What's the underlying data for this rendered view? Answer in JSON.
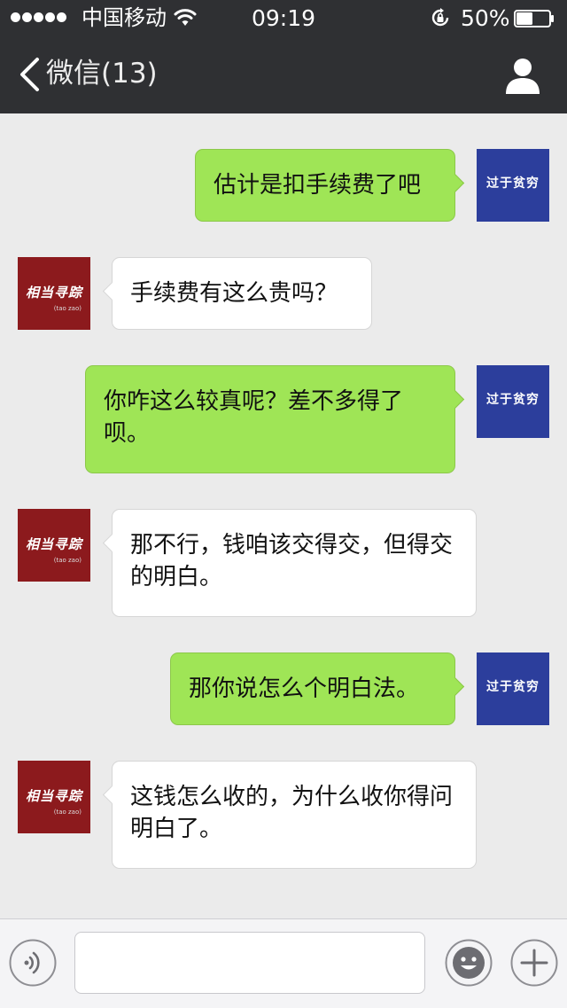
{
  "status_bar": {
    "signal_bars": 5,
    "carrier": "中国移动",
    "time": "09:19",
    "battery_text": "50%",
    "battery_level": 0.5
  },
  "nav": {
    "back_label": "微信(13)",
    "back_icon": "chevron-left-icon",
    "profile_icon": "person-icon"
  },
  "avatars": {
    "me": {
      "text": "过于贫穷",
      "bg": "#2c3e9c"
    },
    "them": {
      "text": "相当寻踪",
      "subtext": "(tao zao)",
      "bg": "#8c1a1d"
    }
  },
  "messages": [
    {
      "sender": "me",
      "text": "估计是扣手续费了吧"
    },
    {
      "sender": "them",
      "text": "手续费有这么贵吗？"
    },
    {
      "sender": "me",
      "text": "你咋这么较真呢？差不多得了呗。"
    },
    {
      "sender": "them",
      "text": "那不行，钱咱该交得交，但得交的明白。"
    },
    {
      "sender": "me",
      "text": "那你说怎么个明白法。"
    },
    {
      "sender": "them",
      "text": "这钱怎么收的，为什么收你得问明白了。"
    }
  ],
  "colors": {
    "bar_bg": "#2f3033",
    "chat_bg": "#ebebeb",
    "my_bubble": "#9fe556",
    "their_bubble": "#ffffff"
  },
  "input": {
    "value": "",
    "placeholder": "",
    "voice_icon": "voice-icon",
    "emoji_icon": "emoji-icon",
    "plus_icon": "plus-icon"
  }
}
